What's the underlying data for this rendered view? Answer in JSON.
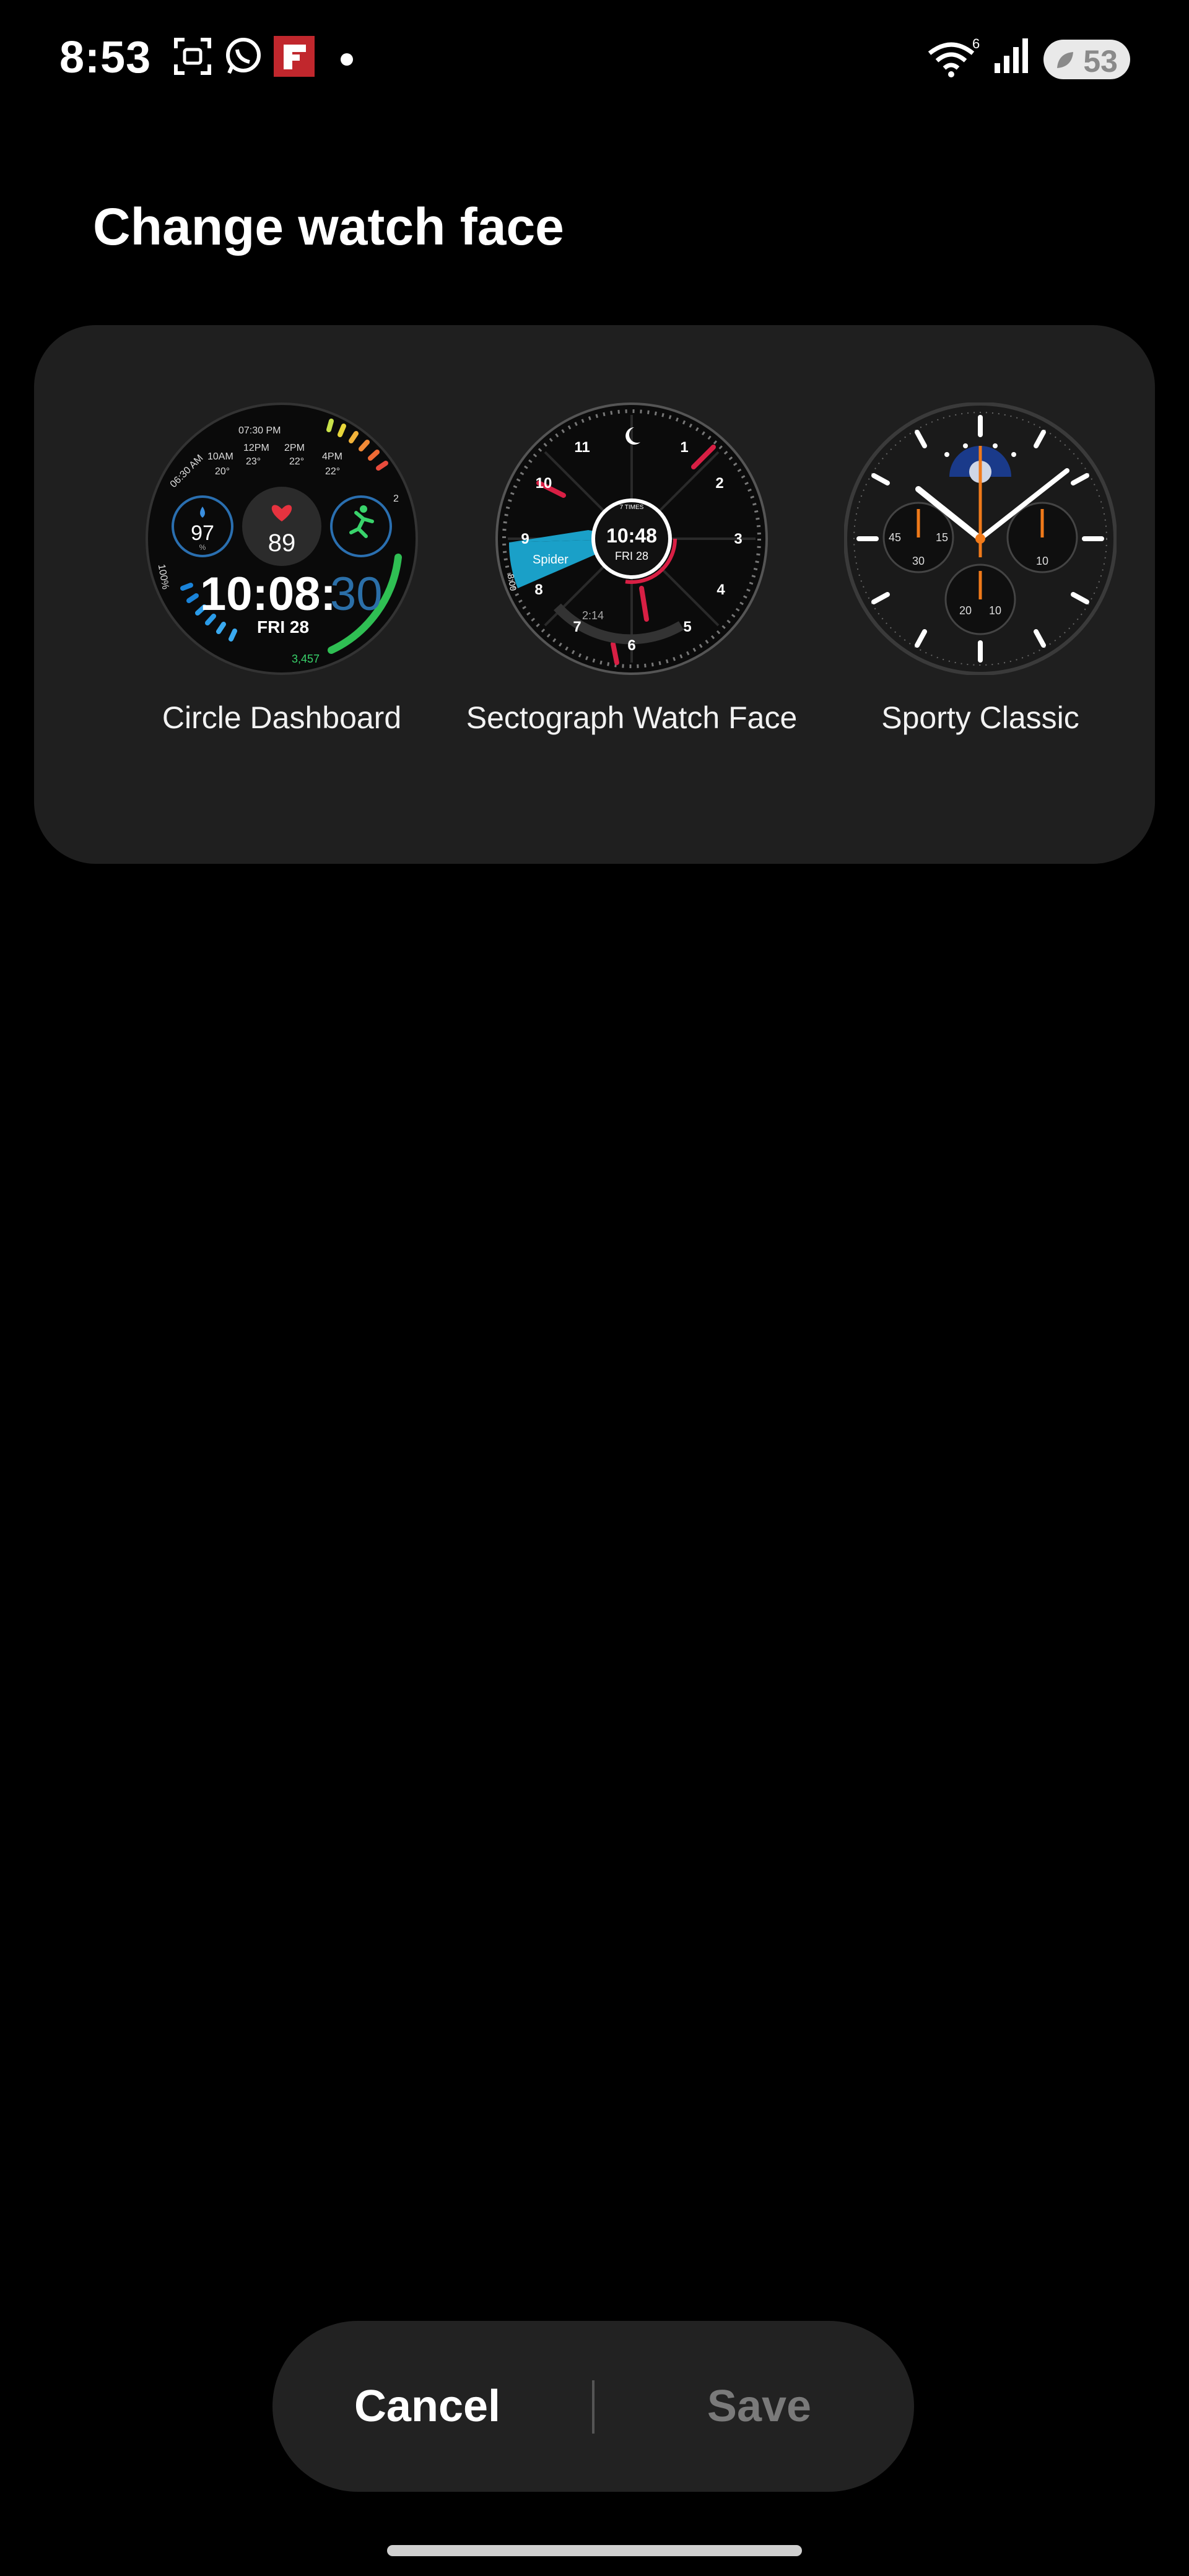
{
  "status_bar": {
    "time": "8:53",
    "battery_level": "53",
    "network_label": "6"
  },
  "page": {
    "title": "Change watch face"
  },
  "faces": [
    {
      "label": "Circle Dashboard",
      "texts": {
        "times": [
          "06:30 AM",
          "07:30 PM"
        ],
        "hours": [
          "10AM",
          "12PM",
          "2PM",
          "4PM"
        ],
        "temps": [
          "20°",
          "23°",
          "22°",
          "22°"
        ],
        "spo2": "97",
        "spo2_unit": "%",
        "heart": "89",
        "battery": "100%",
        "clock": "10:08:",
        "seconds": "30",
        "date": "FRI 28",
        "steps": "3,457",
        "right_mark": "2"
      }
    },
    {
      "label": "Sectograph Watch Face",
      "texts": {
        "numerals": [
          "11",
          "1",
          "2",
          "3",
          "10",
          "4",
          "5",
          "6",
          "7",
          "8",
          "9"
        ],
        "center_time": "10:48",
        "center_date": "FRI 28",
        "event": "Spider",
        "event_time": "8:00",
        "arc_text": "2:14",
        "small_top": "7 TIMES"
      }
    },
    {
      "label": "Sporty Classic",
      "texts": {
        "sub_left": [
          "45",
          "15",
          "30"
        ],
        "sub_right": [
          "10"
        ],
        "sub_bottom": [
          "20",
          "10"
        ]
      }
    }
  ],
  "actions": {
    "cancel": "Cancel",
    "save": "Save"
  }
}
